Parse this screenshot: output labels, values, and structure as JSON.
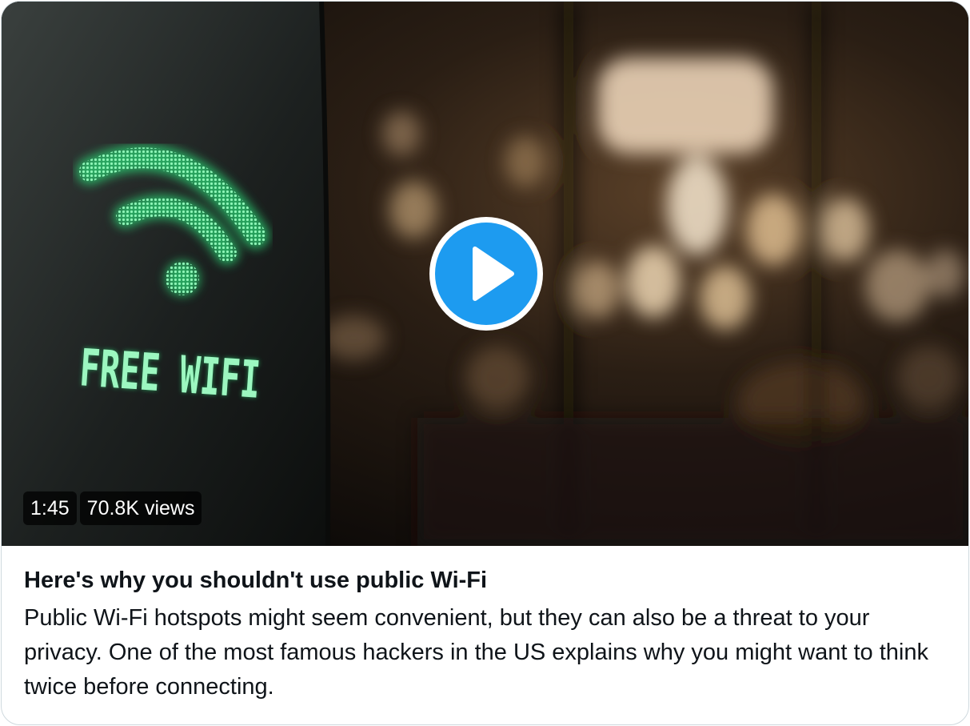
{
  "media": {
    "sign_text": "FREE WIFI",
    "duration": "1:45",
    "views": "70.8K views",
    "play_icon": "play-icon"
  },
  "card": {
    "headline": "Here's why you shouldn't use public Wi-Fi",
    "description": "Public Wi-Fi hotspots might seem convenient, but they can also be a threat to your privacy. One of the most famous hackers in the US explains why you might want to think twice before connecting."
  },
  "colors": {
    "accent": "#1d9bf0",
    "wifi_glow": "#5fe39a",
    "text": "#0f1419",
    "border": "#cfd9de"
  }
}
